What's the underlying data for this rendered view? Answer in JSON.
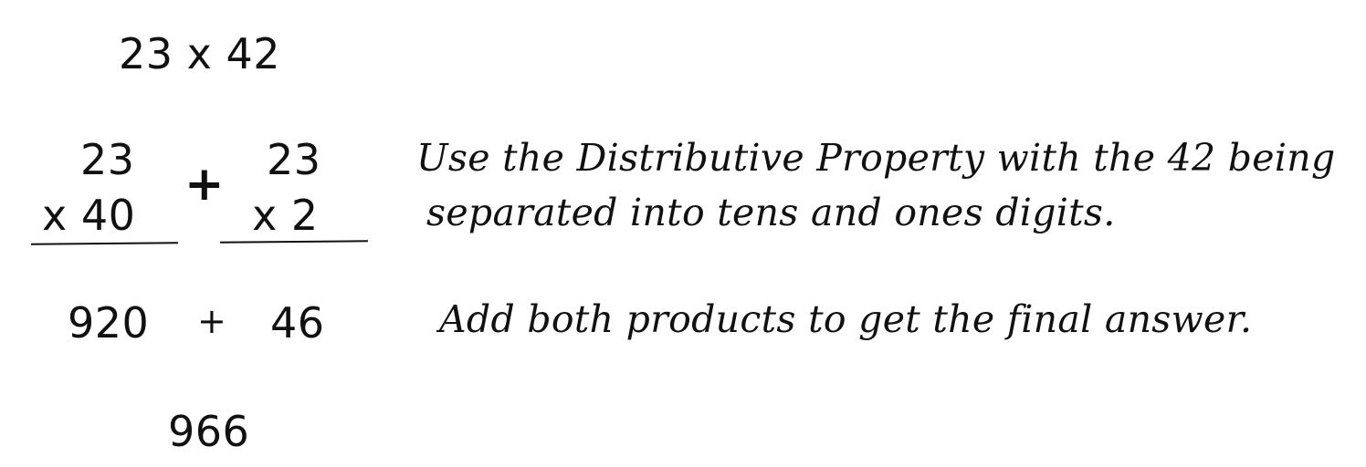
{
  "problem": {
    "expression": "23 x 42"
  },
  "partials": {
    "left": {
      "multiplicand": "23",
      "multiplier": "x  40"
    },
    "operator": "+",
    "right": {
      "multiplicand": "23",
      "multiplier": "x  2"
    }
  },
  "notes": {
    "distributive_line1": "Use the Distributive Property with the 42 being",
    "distributive_line2": "separated into tens and ones digits.",
    "add_products": "Add both products to get the final answer."
  },
  "products": {
    "first": "920",
    "operator": "+",
    "second": "46"
  },
  "answer": {
    "value": "966"
  }
}
